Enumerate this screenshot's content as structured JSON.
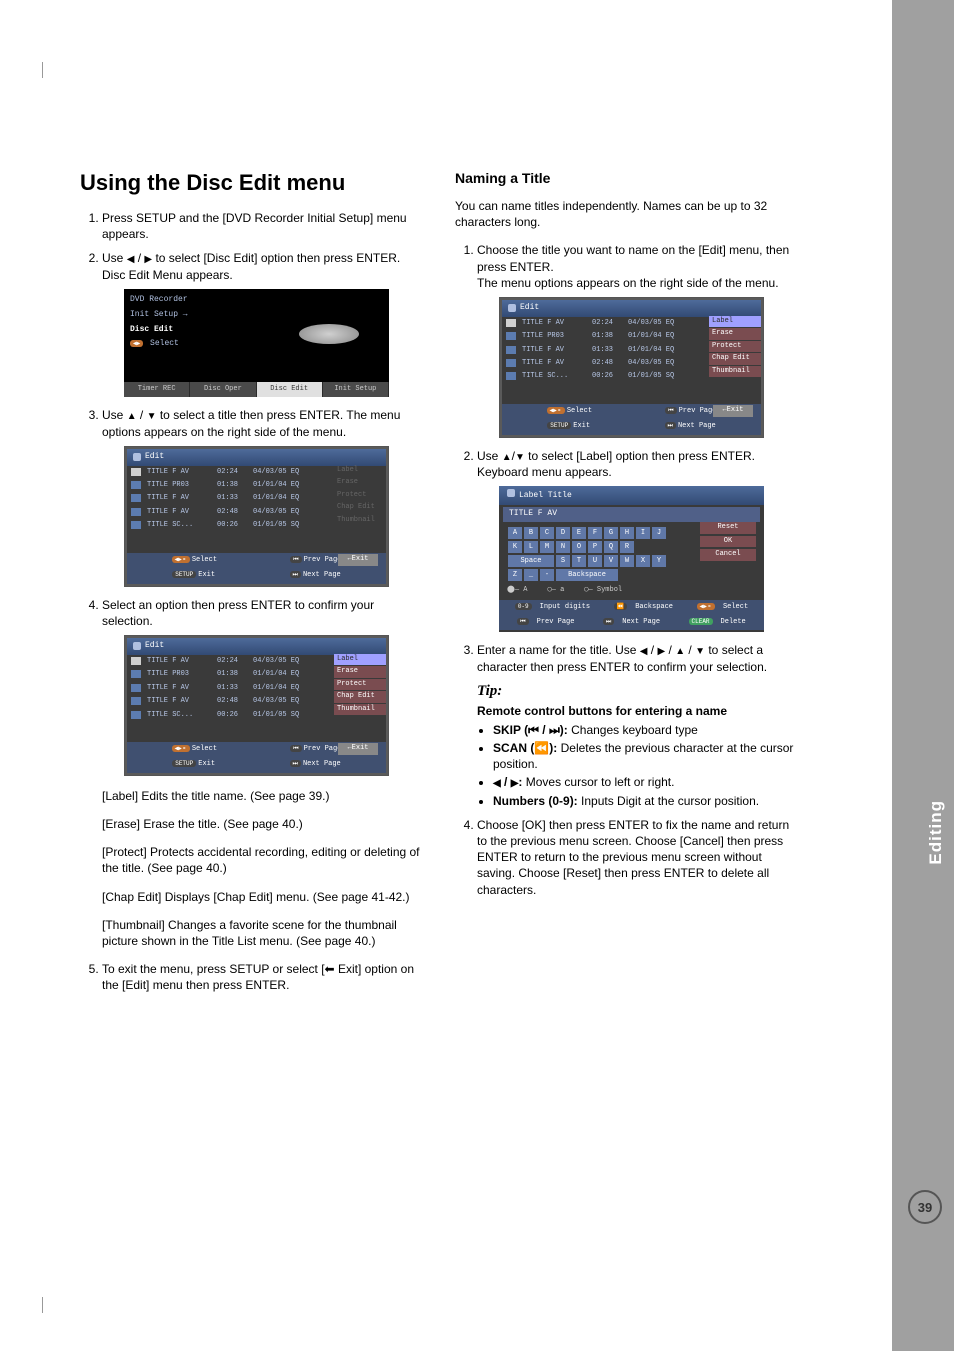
{
  "sidebar": {
    "label": "Editing"
  },
  "page_number": "39",
  "left": {
    "h1": "Using the Disc Edit menu",
    "steps": {
      "s1": "Press SETUP and the [DVD Recorder Initial Setup] menu appears.",
      "s2_a": "Use ",
      "s2_b": " to select [Disc Edit] option then press ENTER. Disc Edit Menu appears.",
      "s2_sep": " / ",
      "s3_a": "Use ",
      "s3_b": " to select a title then press ENTER. The menu options appears on the right side of the menu.",
      "s4": "Select an option then press ENTER to confirm your selection.",
      "s5_a": "To exit the menu, press SETUP or select [",
      "s5_b": " Exit] option on the [Edit] menu then press ENTER."
    },
    "descs": {
      "d1": "[Label] Edits the title name. (See page 39.)",
      "d2": "[Erase] Erase the title. (See page 40.)",
      "d3": "[Protect] Protects accidental recording, editing or deleting of the title. (See page 40.)",
      "d4": "[Chap Edit] Displays [Chap Edit] menu. (See page 41-42.)",
      "d5": "[Thumbnail] Changes a favorite scene for the thumbnail picture shown in the Title List menu. (See page 40.)"
    },
    "setup_screen": {
      "line1": "DVD Recorder",
      "line2": "Init Setup →",
      "line3": "Disc Edit",
      "line4": "◀▶ Select",
      "tab1": "Timer REC",
      "tab2": "Disc Oper",
      "tab3": "Disc Edit",
      "tab4": "Init Setup"
    }
  },
  "right": {
    "h2": "Naming a Title",
    "intro": "You can name titles independently. Names can be up to 32 characters long.",
    "steps": {
      "s1_a": "Choose the title you want to name on the [Edit] menu, then press ENTER.",
      "s1_b": "The menu options appears on the right side of the menu.",
      "s2_a": "Use ",
      "s2_b": " to select [Label] option then press ENTER.",
      "s2_c": "Keyboard menu appears.",
      "s3_a": "Enter a name for the title. Use ",
      "s3_b": " to select a character then press ENTER to confirm your selection.",
      "s4": "Choose [OK] then press ENTER to fix the name and return to the previous menu screen. Choose [Cancel] then press ENTER to return to the previous menu screen without saving. Choose [Reset] then press ENTER to delete all characters."
    },
    "tip_label": "Tip:",
    "tip_heading": "Remote control buttons for entering a name",
    "tips": {
      "t1_a": "SKIP (",
      "t1_b": "):",
      "t1_c": " Changes keyboard type",
      "t2_a": "SCAN (",
      "t2_b": "):",
      "t2_c": " Deletes the previous character at the cursor position.",
      "t3_a": ":",
      "t3_b": " Moves cursor to left or right.",
      "t4_a": "Numbers (0-9):",
      "t4_b": " Inputs Digit at the cursor position."
    }
  },
  "edit_screen": {
    "title": "Edit",
    "rows": [
      {
        "name": "TITLE F AV",
        "dur": "02:24",
        "date": "04/03/05 EQ"
      },
      {
        "name": "TITLE PR03",
        "dur": "01:38",
        "date": "01/01/04 EQ"
      },
      {
        "name": "TITLE F AV",
        "dur": "01:33",
        "date": "01/01/04 EQ"
      },
      {
        "name": "TITLE F AV",
        "dur": "02:48",
        "date": "04/03/05 EQ"
      },
      {
        "name": "TITLE SC...",
        "dur": "00:26",
        "date": "01/01/05 SQ"
      }
    ],
    "menu": {
      "m1": "Label",
      "m2": "Erase",
      "m3": "Protect",
      "m4": "Chap Edit",
      "m5": "Thumbnail"
    },
    "exit": "←Exit",
    "footer": {
      "f1": "Select",
      "f2": "Exit",
      "f3": "Prev Page",
      "f4": "Next Page"
    }
  },
  "kbd": {
    "header": "Label Title",
    "titlebar": "TITLE F AV",
    "space": "Space",
    "bksp": "Backspace",
    "reset": "Reset",
    "ok": "OK",
    "cancel": "Cancel",
    "leg_a": "— A",
    "leg_b": "— a",
    "leg_c": "— Symbol",
    "f1": "Input digits",
    "f2": "Backspace",
    "f3": "Select",
    "f4": "Prev Page",
    "f5": "Next Page",
    "f6": "Delete"
  }
}
